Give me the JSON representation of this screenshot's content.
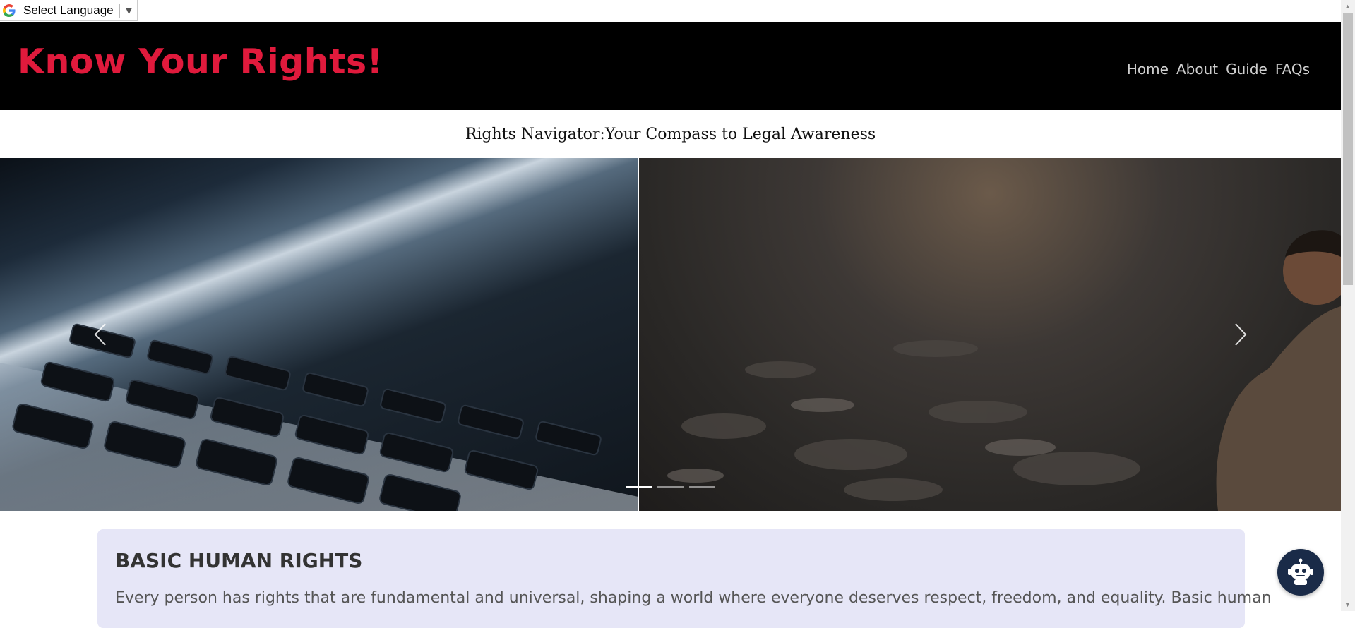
{
  "translate": {
    "label": "Select Language",
    "arrow": "▼"
  },
  "header": {
    "brand": "Know Your Rights!",
    "nav": [
      {
        "label": "Home"
      },
      {
        "label": "About"
      },
      {
        "label": "Guide"
      },
      {
        "label": "FAQs"
      }
    ]
  },
  "tagline": "Rights Navigator:Your Compass to Legal Awareness",
  "carousel": {
    "active_index": 0,
    "slide_count": 3,
    "prev_icon": "chevron-left-icon",
    "next_icon": "chevron-right-icon"
  },
  "section": {
    "heading": "BASIC HUMAN RIGHTS",
    "text": "Every person has rights that are fundamental and universal, shaping a world where everyone deserves respect, freedom, and equality. Basic human"
  },
  "chatbot": {
    "icon": "robot-icon"
  },
  "colors": {
    "brand": "#e01a3c",
    "header_bg": "#000000",
    "card_bg": "#e6e6f7",
    "chatbot_bg": "#1a2b48"
  }
}
